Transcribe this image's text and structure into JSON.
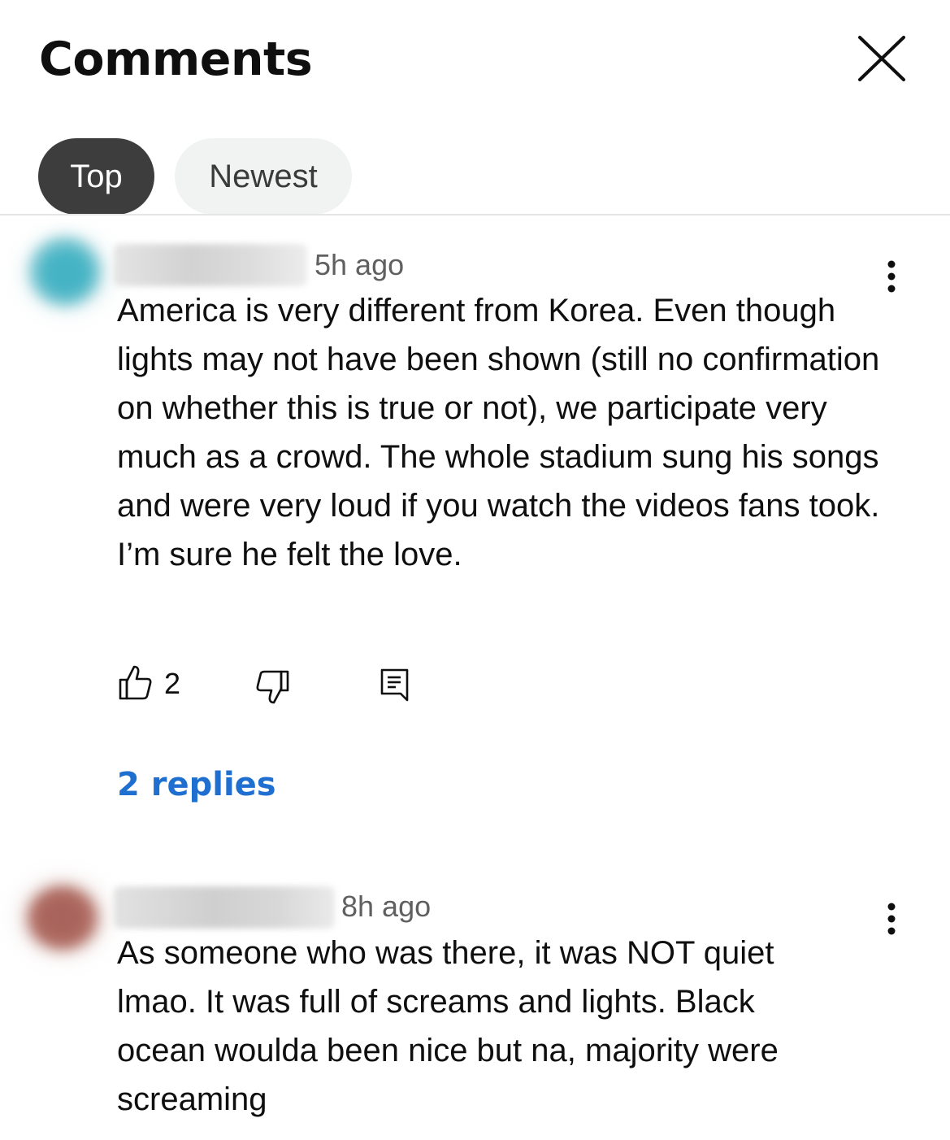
{
  "header": {
    "title": "Comments"
  },
  "filters": {
    "top_label": "Top",
    "newest_label": "Newest"
  },
  "comments": [
    {
      "time": "5h ago",
      "text": "America is very different from Korea. Even though lights may not have been shown (still no confirmation on whether this is true or not), we participate very much as a crowd. The whole stadium sung his songs and were very loud if you watch the videos fans took. I’m sure he felt the love.",
      "likes": "2",
      "replies_label": "2 replies",
      "avatar_color": "#3aaec0"
    },
    {
      "time": "8h ago",
      "text": "As someone who was there, it was NOT quiet lmao. It was full of screams and lights. Black ocean woulda been nice but na, majority were screaming",
      "avatar_color": "#b5746a"
    }
  ],
  "colors": {
    "accent_link": "#1f6fd0",
    "chip_active": "#3d3d3d",
    "chip_inactive": "#f1f2f2"
  }
}
